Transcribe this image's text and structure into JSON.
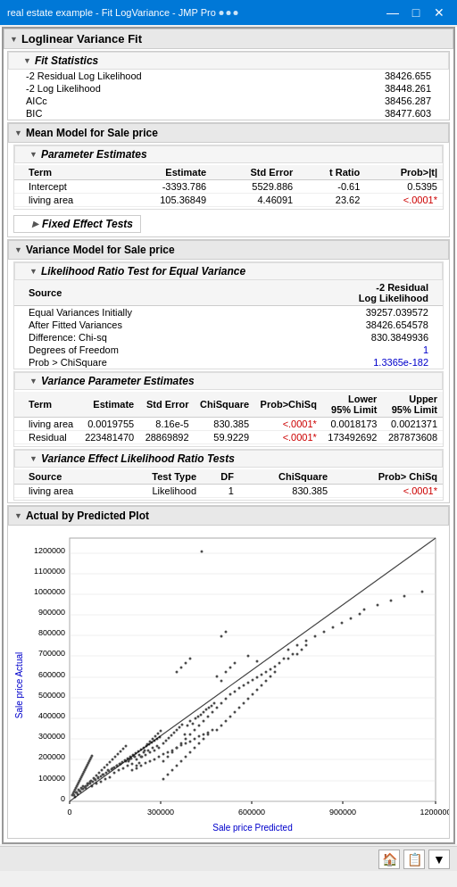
{
  "window": {
    "title": "real estate example - Fit LogVariance - JMP Pro",
    "controls": [
      "—",
      "□",
      "✕"
    ]
  },
  "main_section_title": "Loglinear Variance Fit",
  "fit_statistics": {
    "header": "Fit Statistics",
    "rows": [
      {
        "label": "-2 Residual Log Likelihood",
        "value": "38426.655"
      },
      {
        "label": "-2 Log Likelihood",
        "value": "38448.261"
      },
      {
        "label": "AICc",
        "value": "38456.287"
      },
      {
        "label": "BIC",
        "value": "38477.603"
      }
    ]
  },
  "mean_model": {
    "header": "Mean Model for Sale price",
    "param_estimates": {
      "header": "Parameter Estimates",
      "columns": [
        "Term",
        "Estimate",
        "Std Error",
        "t Ratio",
        "Prob>|t|"
      ],
      "rows": [
        {
          "term": "Intercept",
          "estimate": "-3393.786",
          "std_error": "5529.886",
          "t_ratio": "-0.61",
          "prob": "0.5395",
          "prob_color": "black"
        },
        {
          "term": "living area",
          "estimate": "105.36849",
          "std_error": "4.46091",
          "t_ratio": "23.62",
          "prob": "<.0001*",
          "prob_color": "red"
        }
      ]
    },
    "fixed_effect_tests": "Fixed Effect Tests"
  },
  "variance_model": {
    "header": "Variance Model for Sale price",
    "lrt": {
      "header": "Likelihood Ratio Test for Equal Variance",
      "col1": "Source",
      "col2_line1": "-2 Residual",
      "col2_line2": "Log Likelihood",
      "rows": [
        {
          "source": "Equal Variances Initially",
          "value": "39257.039572"
        },
        {
          "source": "After Fitted Variances",
          "value": "38426.654578"
        },
        {
          "source": "Difference: Chi-sq",
          "value": "830.3849936"
        },
        {
          "source": "Degrees of Freedom",
          "value": "1",
          "value_color": "blue"
        },
        {
          "source": "Prob > ChiSquare",
          "value": "1.3365e-182",
          "value_color": "blue"
        }
      ]
    },
    "var_param_estimates": {
      "header": "Variance Parameter Estimates",
      "columns": [
        "Term",
        "Estimate",
        "Std Error",
        "ChiSquare",
        "Prob>ChiSq",
        "Lower\n95% Limit",
        "Upper\n95% Limit"
      ],
      "rows": [
        {
          "term": "living area",
          "estimate": "0.0019755",
          "std_error": "8.16e-5",
          "chi_sq": "830.385",
          "prob": "<.0001*",
          "prob_color": "red",
          "lower": "0.0018173",
          "upper": "0.0021371"
        },
        {
          "term": "Residual",
          "estimate": "223481470",
          "std_error": "28869892",
          "chi_sq": "59.9229",
          "prob": "<.0001*",
          "prob_color": "red",
          "lower": "173492692",
          "upper": "287873608"
        }
      ]
    },
    "var_effect_lrt": {
      "header": "Variance Effect Likelihood Ratio Tests",
      "columns": [
        "Source",
        "Test Type",
        "DF",
        "ChiSquare",
        "Prob> ChiSq"
      ],
      "rows": [
        {
          "source": "living area",
          "test_type": "Likelihood",
          "df": "1",
          "chi_sq": "830.385",
          "prob": "<.0001*",
          "prob_color": "red"
        }
      ]
    }
  },
  "actual_by_predicted": {
    "header": "Actual by Predicted Plot",
    "x_label": "Sale price Predicted",
    "y_label": "Sale price Actual",
    "x_ticks": [
      "0",
      "300000",
      "600000",
      "900000",
      "1200000"
    ],
    "y_ticks": [
      "0",
      "100000",
      "200000",
      "300000",
      "400000",
      "500000",
      "600000",
      "700000",
      "800000",
      "900000",
      "1000000",
      "1100000",
      "1200000"
    ]
  },
  "bottom_bar": {
    "icons": [
      "🏠",
      "📋",
      "▼"
    ]
  }
}
